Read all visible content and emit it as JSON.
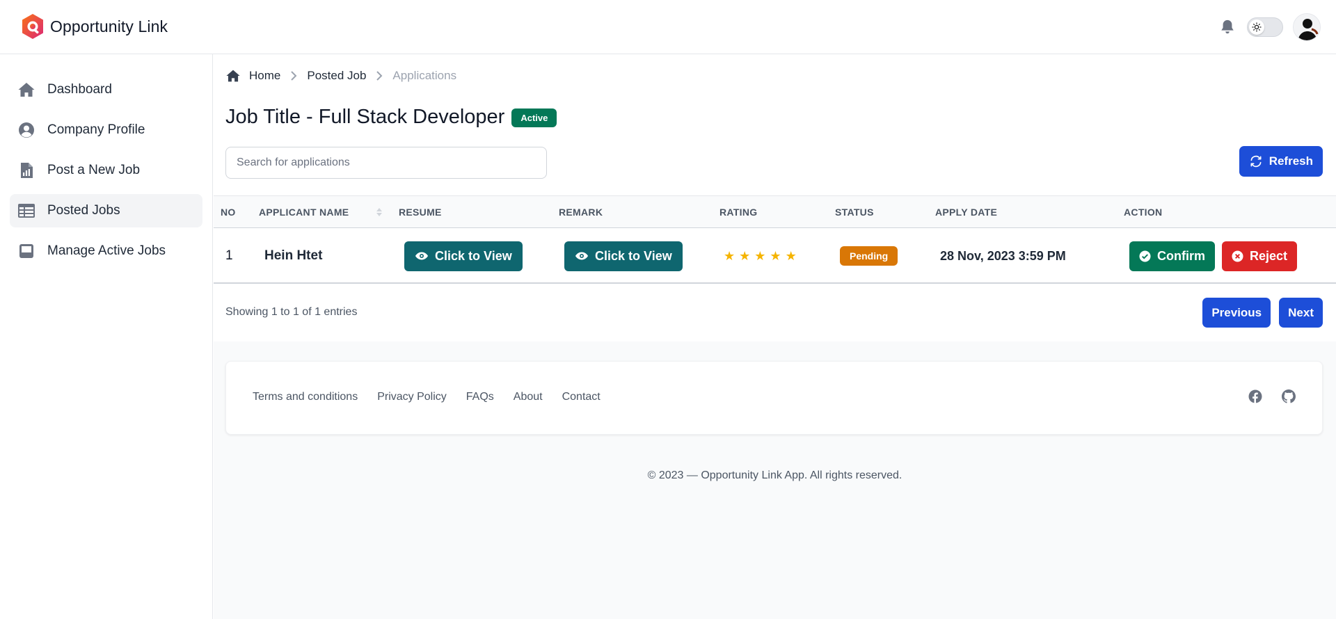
{
  "app": {
    "name": "Opportunity Link"
  },
  "sidebar": {
    "items": [
      {
        "label": "Dashboard",
        "icon": "home-icon"
      },
      {
        "label": "Company Profile",
        "icon": "user-circle-icon"
      },
      {
        "label": "Post a New Job",
        "icon": "document-chart-icon"
      },
      {
        "label": "Posted Jobs",
        "icon": "table-icon",
        "active": true
      },
      {
        "label": "Manage Active Jobs",
        "icon": "inbox-icon"
      }
    ]
  },
  "breadcrumb": {
    "home": "Home",
    "posted_job": "Posted Job",
    "current": "Applications"
  },
  "page": {
    "title": "Job Title - Full Stack Developer",
    "status_badge": "Active"
  },
  "search": {
    "placeholder": "Search for applications",
    "value": ""
  },
  "toolbar": {
    "refresh_label": "Refresh"
  },
  "table": {
    "headers": {
      "no": "NO",
      "applicant_name": "APPLICANT NAME",
      "resume": "RESUME",
      "remark": "REMARK",
      "rating": "RATING",
      "status": "STATUS",
      "apply_date": "APPLY DATE",
      "action": "ACTION"
    },
    "rows": [
      {
        "no": "1",
        "applicant_name": "Hein Htet",
        "resume_label": "Click to View",
        "remark_label": "Click to View",
        "rating": 5,
        "status": "Pending",
        "apply_date": "28 Nov, 2023 3:59 PM",
        "confirm_label": "Confirm",
        "reject_label": "Reject"
      }
    ]
  },
  "pagination": {
    "showing": "Showing 1 to 1 of 1 entries",
    "previous_label": "Previous",
    "next_label": "Next"
  },
  "footer": {
    "links": [
      "Terms and conditions",
      "Privacy Policy",
      "FAQs",
      "About",
      "Contact"
    ],
    "icons": [
      "facebook-icon",
      "github-icon"
    ],
    "copyright": "© 2023 — Opportunity Link App. All rights reserved."
  },
  "colors": {
    "primary": "#1d4ed8",
    "success": "#047857",
    "danger": "#dc2626",
    "warning": "#d97706",
    "teal": "#0f666f",
    "star": "#f5b400"
  }
}
